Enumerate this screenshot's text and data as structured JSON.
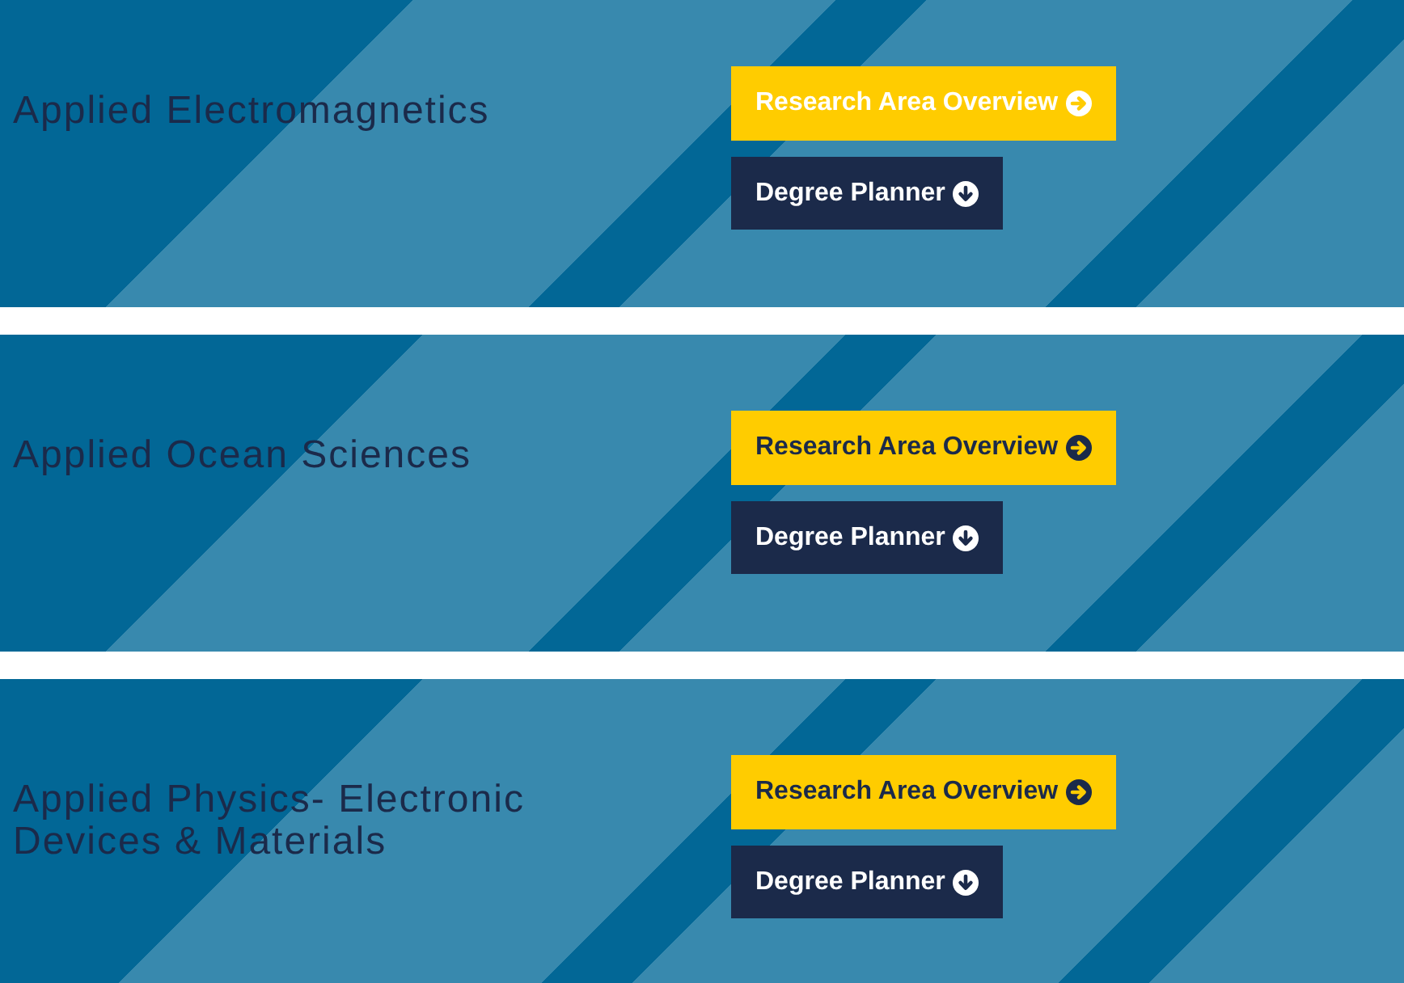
{
  "programs": [
    {
      "title": "Applied Electromagnetics",
      "overview_button": {
        "label": "Research Area Overview",
        "hovered": true
      },
      "planner_button": {
        "label": "Degree Planner"
      }
    },
    {
      "title": "Applied Ocean Sciences",
      "overview_button": {
        "label": "Research Area Overview",
        "hovered": false
      },
      "planner_button": {
        "label": "Degree Planner"
      }
    },
    {
      "title": "Applied Physics- Electronic Devices & Materials",
      "overview_button": {
        "label": "Research Area Overview",
        "hovered": false
      },
      "planner_button": {
        "label": "Degree Planner"
      }
    }
  ]
}
